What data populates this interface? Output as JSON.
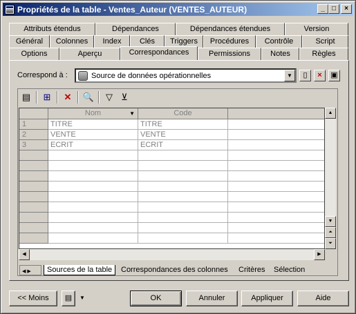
{
  "window": {
    "title": "Propriétés de la table - Ventes_Auteur (VENTES_AUTEUR)"
  },
  "tabs": {
    "row1": [
      "Attributs étendus",
      "Dépendances",
      "Dépendances étendues",
      "Version"
    ],
    "row2": [
      "Général",
      "Colonnes",
      "Index",
      "Clés",
      "Triggers",
      "Procédures",
      "Contrôle",
      "Script"
    ],
    "row3": [
      "Options",
      "Aperçu",
      "Correspondances",
      "Permissions",
      "Notes",
      "Règles"
    ],
    "active": "Correspondances"
  },
  "mapping": {
    "label": "Correspond à :",
    "source_value": "Source de données opérationnelles"
  },
  "grid": {
    "columns": [
      "Nom",
      "Code"
    ],
    "rows": [
      {
        "num": "1",
        "nom": "TITRE",
        "code": "TITRE"
      },
      {
        "num": "2",
        "nom": "VENTE",
        "code": "VENTE"
      },
      {
        "num": "3",
        "nom": "ECRIT",
        "code": "ECRIT"
      }
    ]
  },
  "bottom_tabs": [
    "Sources de la table",
    "Correspondances des colonnes",
    "Critères",
    "Sélection"
  ],
  "buttons": {
    "less": "<< Moins",
    "ok": "OK",
    "cancel": "Annuler",
    "apply": "Appliquer",
    "help": "Aide"
  }
}
